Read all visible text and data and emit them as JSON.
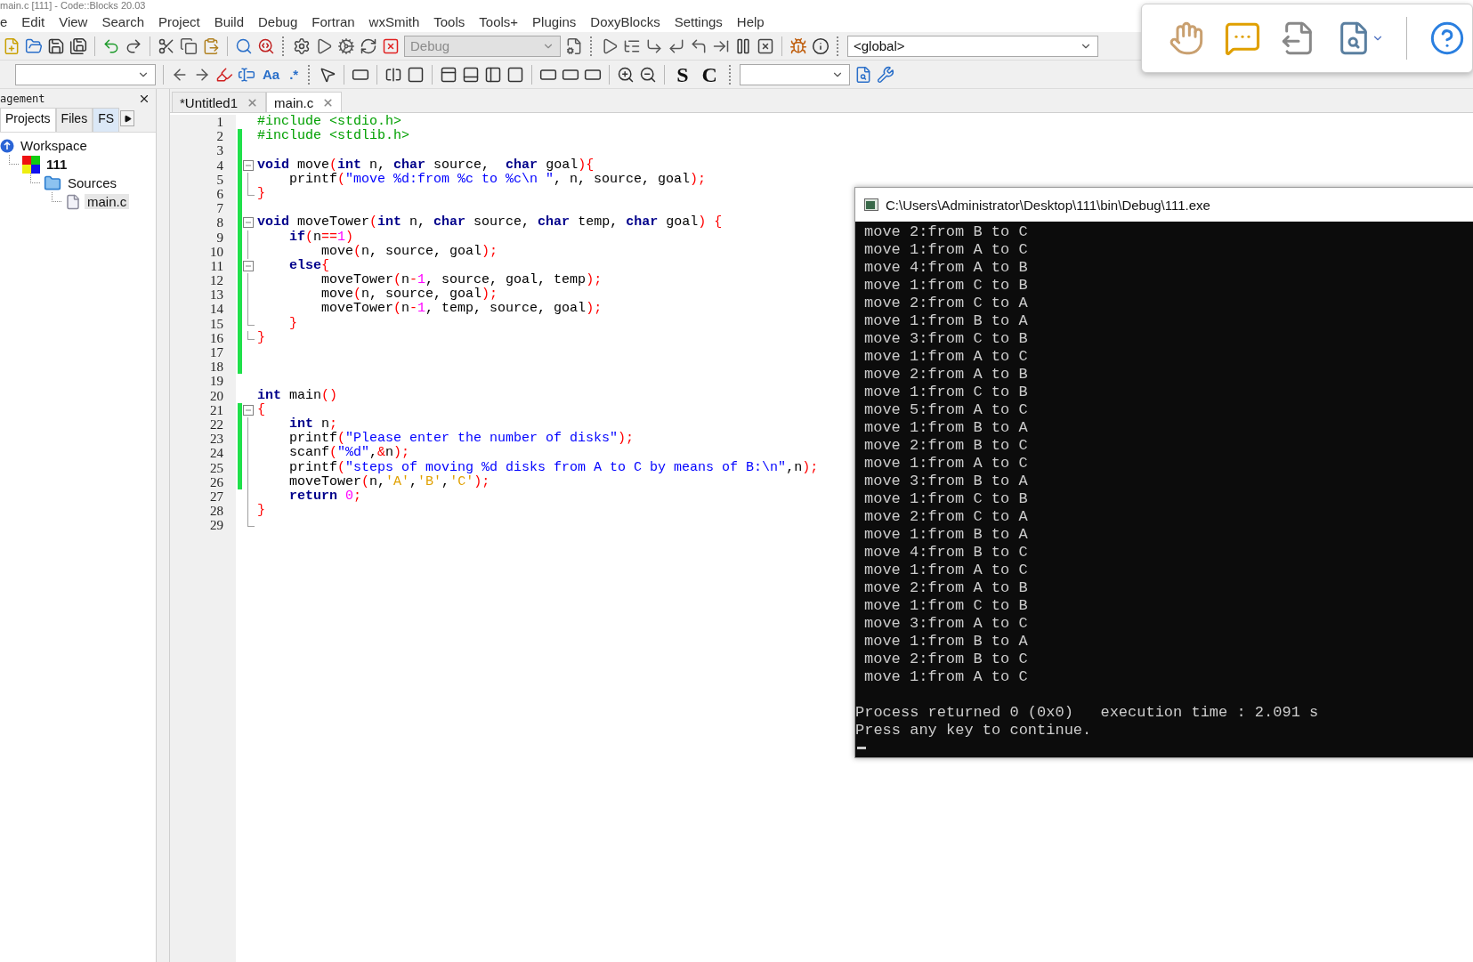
{
  "window": {
    "title": "main.c [111] - Code::Blocks 20.03"
  },
  "menu": [
    "e",
    "Edit",
    "View",
    "Search",
    "Project",
    "Build",
    "Debug",
    "Fortran",
    "wxSmith",
    "Tools",
    "Tools+",
    "Plugins",
    "DoxyBlocks",
    "Settings",
    "Help"
  ],
  "toolbar_1": {
    "build_target": {
      "value": "Debug",
      "disabled": true
    },
    "scope": {
      "value": "<global>"
    }
  },
  "toolbar_2": {
    "search_options": [
      "Aa",
      ".*"
    ],
    "letter_buttons": [
      "S",
      "C"
    ]
  },
  "management": {
    "title": "agement",
    "tabs": [
      {
        "label": "Projects",
        "selected": true
      },
      {
        "label": "Files",
        "selected": false
      },
      {
        "label": "FS",
        "selected": false
      }
    ],
    "tree": [
      {
        "kind": "workspace",
        "label": "Workspace",
        "selected": false,
        "children": [
          {
            "kind": "project",
            "label": "111",
            "selected": false,
            "children": [
              {
                "kind": "folder",
                "label": "Sources",
                "selected": false,
                "children": [
                  {
                    "kind": "file",
                    "label": "main.c",
                    "selected": true
                  }
                ]
              }
            ]
          }
        ]
      }
    ]
  },
  "editor": {
    "tabs": [
      {
        "label": "*Untitled1",
        "selected": false
      },
      {
        "label": "main.c",
        "selected": true
      }
    ],
    "lines": [
      {
        "number": "1",
        "changed": false,
        "kind": "plain",
        "tokens": [
          {
            "kind": "preproc",
            "text": "#include <stdio.h>"
          }
        ]
      },
      {
        "number": "2",
        "changed": true,
        "kind": "plain",
        "tokens": [
          {
            "kind": "preproc",
            "text": "#include <stdlib.h>"
          }
        ]
      },
      {
        "number": "3",
        "changed": true,
        "kind": "plain"
      },
      {
        "number": "4",
        "changed": true,
        "kind": "fold-start",
        "tokens": [
          {
            "kind": "keyword",
            "text": "void"
          },
          {
            "kind": "plain",
            "text": " move"
          },
          {
            "kind": "operator",
            "text": "("
          },
          {
            "kind": "keyword",
            "text": "int"
          },
          {
            "kind": "plain",
            "text": " n, "
          },
          {
            "kind": "keyword",
            "text": "char"
          },
          {
            "kind": "plain",
            "text": " source,  "
          },
          {
            "kind": "keyword",
            "text": "char"
          },
          {
            "kind": "plain",
            "text": " goal"
          },
          {
            "kind": "operator",
            "text": "){"
          }
        ]
      },
      {
        "number": "5",
        "changed": true,
        "kind": "fold-body",
        "tokens": [
          {
            "kind": "plain",
            "text": "    printf"
          },
          {
            "kind": "operator",
            "text": "("
          },
          {
            "kind": "string",
            "text": "\"move %d:from %c to %c\\n \""
          },
          {
            "kind": "plain",
            "text": ", n, source, goal"
          },
          {
            "kind": "operator",
            "text": ");"
          }
        ]
      },
      {
        "number": "6",
        "changed": true,
        "kind": "fold-end",
        "tokens": [
          {
            "kind": "operator",
            "text": "}"
          }
        ]
      },
      {
        "number": "7",
        "changed": true,
        "kind": "plain"
      },
      {
        "number": "8",
        "changed": true,
        "kind": "fold-start",
        "tokens": [
          {
            "kind": "keyword",
            "text": "void"
          },
          {
            "kind": "plain",
            "text": " moveTower"
          },
          {
            "kind": "operator",
            "text": "("
          },
          {
            "kind": "keyword",
            "text": "int"
          },
          {
            "kind": "plain",
            "text": " n, "
          },
          {
            "kind": "keyword",
            "text": "char"
          },
          {
            "kind": "plain",
            "text": " source, "
          },
          {
            "kind": "keyword",
            "text": "char"
          },
          {
            "kind": "plain",
            "text": " temp, "
          },
          {
            "kind": "keyword",
            "text": "char"
          },
          {
            "kind": "plain",
            "text": " goal"
          },
          {
            "kind": "operator",
            "text": ")"
          },
          {
            "kind": "operator",
            "text": " {"
          }
        ]
      },
      {
        "number": "9",
        "changed": true,
        "kind": "fold-body",
        "tokens": [
          {
            "kind": "keyword",
            "text": "    if"
          },
          {
            "kind": "operator",
            "text": "("
          },
          {
            "kind": "plain",
            "text": "n"
          },
          {
            "kind": "operator",
            "text": "=="
          },
          {
            "kind": "number",
            "text": "1"
          },
          {
            "kind": "operator",
            "text": ")"
          }
        ]
      },
      {
        "number": "10",
        "changed": true,
        "kind": "fold-body",
        "tokens": [
          {
            "kind": "plain",
            "text": "        move"
          },
          {
            "kind": "operator",
            "text": "("
          },
          {
            "kind": "plain",
            "text": "n, source, goal"
          },
          {
            "kind": "operator",
            "text": ");"
          }
        ]
      },
      {
        "number": "11",
        "changed": true,
        "kind": "fold-start",
        "tokens": [
          {
            "kind": "keyword",
            "text": "    else"
          },
          {
            "kind": "operator",
            "text": "{"
          }
        ]
      },
      {
        "number": "12",
        "changed": true,
        "kind": "fold-body",
        "tokens": [
          {
            "kind": "plain",
            "text": "        moveTower"
          },
          {
            "kind": "operator",
            "text": "("
          },
          {
            "kind": "plain",
            "text": "n"
          },
          {
            "kind": "operator",
            "text": "-"
          },
          {
            "kind": "number",
            "text": "1"
          },
          {
            "kind": "plain",
            "text": ", source, goal, temp"
          },
          {
            "kind": "operator",
            "text": ");"
          }
        ]
      },
      {
        "number": "13",
        "changed": true,
        "kind": "fold-body",
        "tokens": [
          {
            "kind": "plain",
            "text": "        move"
          },
          {
            "kind": "operator",
            "text": "("
          },
          {
            "kind": "plain",
            "text": "n, source, goal"
          },
          {
            "kind": "operator",
            "text": ");"
          }
        ]
      },
      {
        "number": "14",
        "changed": true,
        "kind": "fold-body",
        "tokens": [
          {
            "kind": "plain",
            "text": "        moveTower"
          },
          {
            "kind": "operator",
            "text": "("
          },
          {
            "kind": "plain",
            "text": "n"
          },
          {
            "kind": "operator",
            "text": "-"
          },
          {
            "kind": "number",
            "text": "1"
          },
          {
            "kind": "plain",
            "text": ", temp, source, goal"
          },
          {
            "kind": "operator",
            "text": ");"
          }
        ]
      },
      {
        "number": "15",
        "changed": true,
        "kind": "fold-end",
        "tokens": [
          {
            "kind": "operator",
            "text": "    }"
          }
        ]
      },
      {
        "number": "16",
        "changed": true,
        "kind": "fold-end",
        "tokens": [
          {
            "kind": "operator",
            "text": "}"
          }
        ]
      },
      {
        "number": "17",
        "changed": true,
        "kind": "plain"
      },
      {
        "number": "18",
        "changed": true,
        "kind": "plain"
      },
      {
        "number": "19",
        "changed": false,
        "kind": "plain"
      },
      {
        "number": "20",
        "changed": false,
        "kind": "plain",
        "tokens": [
          {
            "kind": "keyword",
            "text": "int"
          },
          {
            "kind": "plain",
            "text": " main"
          },
          {
            "kind": "operator",
            "text": "()"
          }
        ]
      },
      {
        "number": "21",
        "changed": true,
        "kind": "fold-start",
        "tokens": [
          {
            "kind": "operator",
            "text": "{"
          }
        ]
      },
      {
        "number": "22",
        "changed": true,
        "kind": "fold-body",
        "tokens": [
          {
            "kind": "keyword",
            "text": "    int"
          },
          {
            "kind": "plain",
            "text": " n"
          },
          {
            "kind": "operator",
            "text": ";"
          }
        ]
      },
      {
        "number": "23",
        "changed": true,
        "kind": "fold-body",
        "tokens": [
          {
            "kind": "plain",
            "text": "    printf"
          },
          {
            "kind": "operator",
            "text": "("
          },
          {
            "kind": "string",
            "text": "\"Please enter the number of disks\""
          },
          {
            "kind": "operator",
            "text": ");"
          }
        ]
      },
      {
        "number": "24",
        "changed": true,
        "kind": "fold-body",
        "tokens": [
          {
            "kind": "plain",
            "text": "    scanf"
          },
          {
            "kind": "operator",
            "text": "("
          },
          {
            "kind": "string",
            "text": "\"%d\""
          },
          {
            "kind": "plain",
            "text": ","
          },
          {
            "kind": "operator",
            "text": "&"
          },
          {
            "kind": "plain",
            "text": "n"
          },
          {
            "kind": "operator",
            "text": ");"
          }
        ]
      },
      {
        "number": "25",
        "changed": true,
        "kind": "fold-body",
        "tokens": [
          {
            "kind": "plain",
            "text": "    printf"
          },
          {
            "kind": "operator",
            "text": "("
          },
          {
            "kind": "string",
            "text": "\"steps of moving %d disks from A to C by means of B:\\n\""
          },
          {
            "kind": "plain",
            "text": ",n"
          },
          {
            "kind": "operator",
            "text": ");"
          }
        ]
      },
      {
        "number": "26",
        "changed": true,
        "kind": "fold-body",
        "tokens": [
          {
            "kind": "plain",
            "text": "    moveTower"
          },
          {
            "kind": "operator",
            "text": "("
          },
          {
            "kind": "plain",
            "text": "n,"
          },
          {
            "kind": "char",
            "text": "'A'"
          },
          {
            "kind": "plain",
            "text": ","
          },
          {
            "kind": "char",
            "text": "'B'"
          },
          {
            "kind": "plain",
            "text": ","
          },
          {
            "kind": "char",
            "text": "'C'"
          },
          {
            "kind": "operator",
            "text": ");"
          }
        ]
      },
      {
        "number": "27",
        "changed": false,
        "kind": "fold-body",
        "tokens": [
          {
            "kind": "keyword",
            "text": "    return"
          },
          {
            "kind": "number",
            "text": " 0"
          },
          {
            "kind": "operator",
            "text": ";"
          }
        ]
      },
      {
        "number": "28",
        "changed": false,
        "kind": "fold-body",
        "tokens": [
          {
            "kind": "operator",
            "text": "}"
          }
        ]
      },
      {
        "number": "29",
        "changed": false,
        "kind": "fold-end"
      }
    ]
  },
  "console": {
    "title": "C:\\Users\\Administrator\\Desktop\\111\\bin\\Debug\\111.exe",
    "lines": [
      "move 2:from B to C",
      "move 1:from A to C",
      "move 4:from A to B",
      "move 1:from C to B",
      "move 2:from C to A",
      "move 1:from B to A",
      "move 3:from C to B",
      "move 1:from A to C",
      "move 2:from A to B",
      "move 1:from C to B",
      "move 5:from A to C",
      "move 1:from B to A",
      "move 2:from B to C",
      "move 1:from A to C",
      "move 3:from B to A",
      "move 1:from C to B",
      "move 2:from C to A",
      "move 1:from B to A",
      "move 4:from B to C",
      "move 1:from A to C",
      "move 2:from A to B",
      "move 1:from C to B",
      "move 3:from A to C",
      "move 1:from B to A",
      "move 2:from B to C",
      "move 1:from A to C"
    ],
    "summary": [
      "Process returned 0 (0x0)   execution time : 2.091 s",
      "Press any key to continue."
    ]
  }
}
